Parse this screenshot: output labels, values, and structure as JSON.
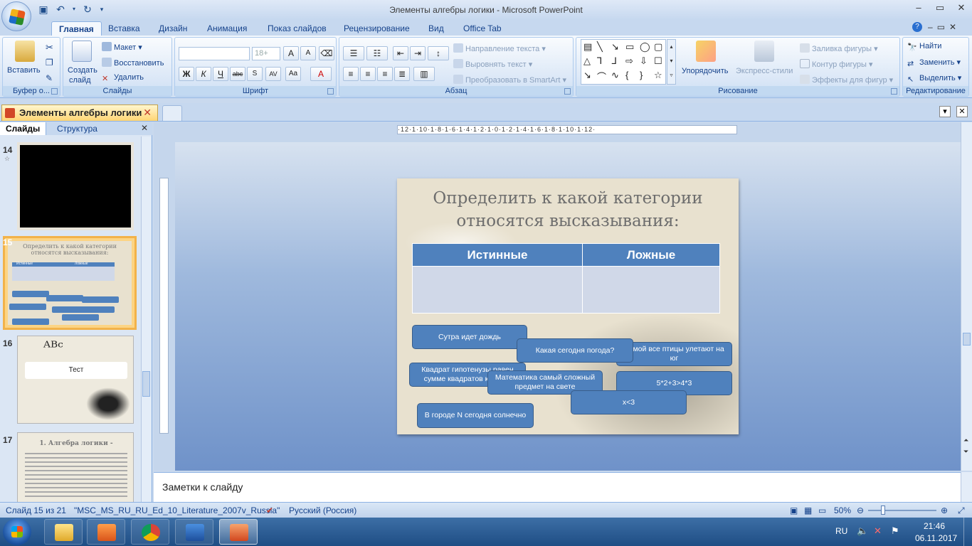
{
  "window": {
    "title": "Элементы алгебры логики - Microsoft PowerPoint"
  },
  "tabs": [
    "Главная",
    "Вставка",
    "Дизайн",
    "Анимация",
    "Показ слайдов",
    "Рецензирование",
    "Вид",
    "Office Tab"
  ],
  "ribbon": {
    "clipboard": {
      "label": "Буфер о...",
      "paste": "Вставить"
    },
    "slides": {
      "label": "Слайды",
      "new_slide_1": "Создать",
      "new_slide_2": "слайд",
      "layout": "Макет",
      "reset": "Восстановить",
      "delete": "Удалить"
    },
    "font": {
      "label": "Шрифт",
      "size": "18+"
    },
    "paragraph": {
      "label": "Абзац",
      "text_dir": "Направление текста",
      "align_text": "Выровнять текст",
      "smartart": "Преобразовать в SmartArt"
    },
    "drawing": {
      "label": "Рисование",
      "arrange": "Упорядочить",
      "quick_styles": "Экспресс-стили",
      "fill": "Заливка фигуры",
      "outline": "Контур фигуры",
      "effects": "Эффекты для фигур"
    },
    "editing": {
      "label": "Редактирование",
      "find": "Найти",
      "replace": "Заменить",
      "select": "Выделить"
    }
  },
  "document_tab": {
    "title": "Элементы алгебры логики"
  },
  "pane": {
    "tab_slides": "Слайды",
    "tab_outline": "Структура",
    "thumbs": [
      {
        "num": "14"
      },
      {
        "num": "15",
        "title": "Определить к какой категории относятся высказывания:",
        "col1": "Истинные",
        "col2": "Ложные"
      },
      {
        "num": "16",
        "text": "Тест"
      },
      {
        "num": "17",
        "title": "1. Алгебра логики -"
      }
    ]
  },
  "ruler": {
    "h": "·12·1·10·1·8·1·6·1·4·1·2·1·0·1·2·1·4·1·6·1·8·1·10·1·12·"
  },
  "slide": {
    "title_line1": "Определить к какой категории",
    "title_line2": "относятся высказывания:",
    "col_true": "Истинные",
    "col_false": "Ложные",
    "cards": [
      "Сутра идет дождь",
      "Какая сегодня погода?",
      "Зимой все птицы улетают на юг",
      "Квадрат гипотенузы равен сумме квадратов катетов",
      "Математика самый сложный предмет на свете",
      "5*2+3>4*3",
      "x<3",
      "В городе N сегодня солнечно"
    ]
  },
  "notes": {
    "placeholder": "Заметки к слайду"
  },
  "status": {
    "slide": "Слайд 15 из 21",
    "theme": "\"MSC_MS_RU_RU_Ed_10_Literature_2007v_Russia\"",
    "language": "Русский (Россия)",
    "zoom": "50%"
  },
  "taskbar": {
    "lang": "RU",
    "time": "21:46",
    "date": "06.11.2017"
  },
  "colors": {
    "accent": "#4f81bd",
    "ribbon": "#dbe7f6",
    "selected_thumb": "#f2b24a"
  }
}
